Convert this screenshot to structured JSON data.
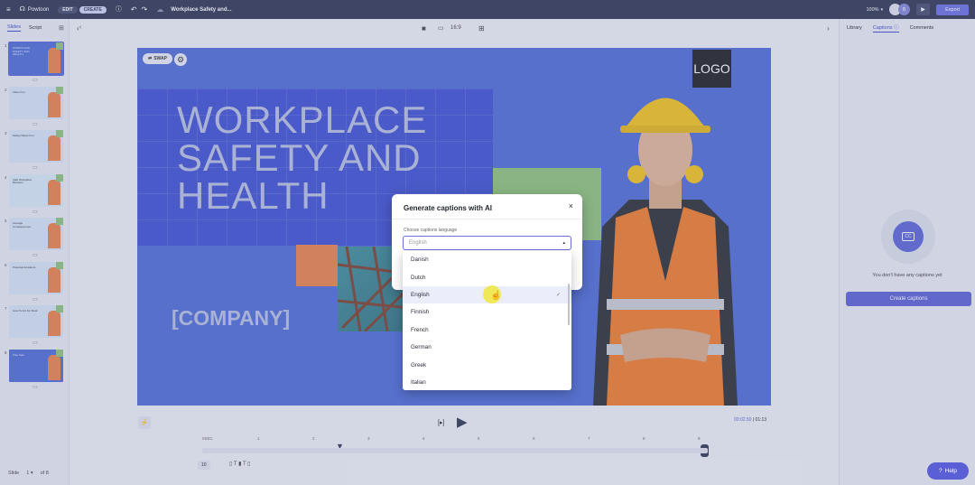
{
  "topbar": {
    "brand": "Powtoon",
    "edit_label": "EDIT",
    "create_label": "CREATE",
    "doc_title": "Workplace Safety and...",
    "zoom": "100%",
    "avatar_initial": "B",
    "export_label": "Export"
  },
  "left_panel": {
    "tabs": [
      "Slides",
      "Script"
    ],
    "slides": [
      {
        "num": "1",
        "title": "WORKPLACE SAFETY AND HEALTH"
      },
      {
        "num": "2",
        "title": "Video Fun"
      },
      {
        "num": "3",
        "title": "Safety Meets Fun"
      },
      {
        "num": "4",
        "title": "Safe Workplace Behavior"
      },
      {
        "num": "5",
        "title": "Average Consequences"
      },
      {
        "num": "6",
        "title": "Potential Accidents"
      },
      {
        "num": "7",
        "title": "How To Act For Real"
      },
      {
        "num": "8",
        "title": "Stay Safe"
      }
    ],
    "footer": {
      "slide_label": "Slide",
      "current": "1",
      "of_label": "of 8"
    }
  },
  "stage": {
    "aspect": "16:9",
    "swap_label": "SWAP"
  },
  "slide": {
    "title_lines": [
      "WORKPLACE",
      "SAFETY AND",
      "HEALTH"
    ],
    "company": "[COMPANY]",
    "logo": "LOGO"
  },
  "right_panel": {
    "tabs": [
      "Library",
      "Captions",
      "Comments"
    ],
    "empty_text": "You don't have any captions yet",
    "create_button": "Create captions",
    "cc_icon_text": "CC"
  },
  "modal": {
    "title": "Generate captions with AI",
    "field_label": "Choose captions language",
    "field_value": "English",
    "options": [
      "Danish",
      "Dutch",
      "English",
      "Finnish",
      "French",
      "German",
      "Greek",
      "Italian"
    ],
    "selected": "English"
  },
  "player": {
    "time_current": "00:02.50",
    "time_total": "01:13",
    "ruler": [
      "0SEC",
      "1",
      "2",
      "3",
      "4",
      "5",
      "6",
      "7",
      "8",
      "9"
    ],
    "duration_chip": "10"
  },
  "help_label": "Help",
  "colors": {
    "accent": "#5b5fd6",
    "topbar": "#2e3452",
    "canvas_blue": "#4d6bd6",
    "title_block": "#3d4fd1",
    "orange": "#e9804a",
    "green": "#8fc27a"
  }
}
